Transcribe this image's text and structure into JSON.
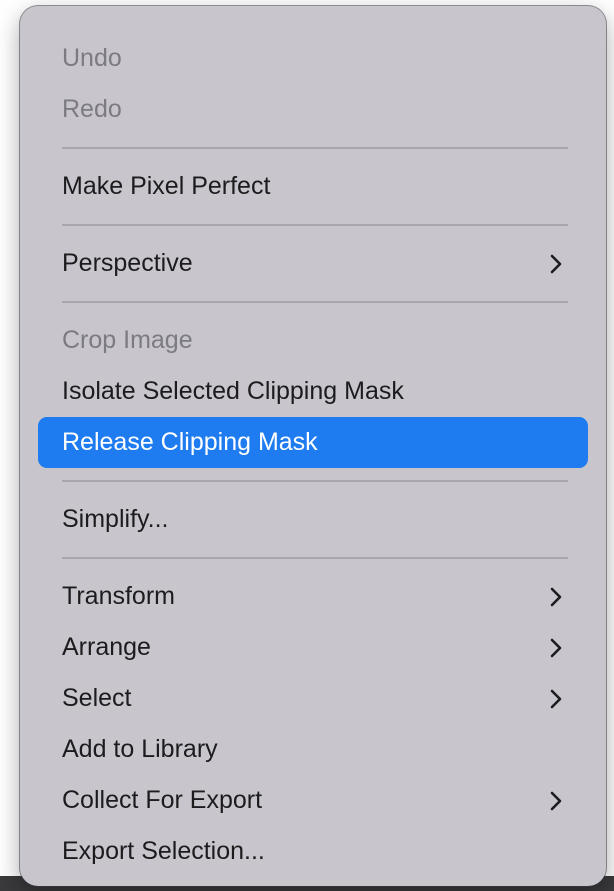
{
  "menu": {
    "groups": [
      {
        "items": [
          {
            "label": "Undo",
            "enabled": false
          },
          {
            "label": "Redo",
            "enabled": false
          }
        ]
      },
      {
        "items": [
          {
            "label": "Make Pixel Perfect",
            "enabled": true
          }
        ]
      },
      {
        "items": [
          {
            "label": "Perspective",
            "enabled": true,
            "submenu": true
          }
        ]
      },
      {
        "items": [
          {
            "label": "Crop Image",
            "enabled": false
          },
          {
            "label": "Isolate Selected Clipping Mask",
            "enabled": true
          },
          {
            "label": "Release Clipping Mask",
            "enabled": true,
            "highlighted": true
          }
        ]
      },
      {
        "items": [
          {
            "label": "Simplify...",
            "enabled": true
          }
        ]
      },
      {
        "items": [
          {
            "label": "Transform",
            "enabled": true,
            "submenu": true
          },
          {
            "label": "Arrange",
            "enabled": true,
            "submenu": true
          },
          {
            "label": "Select",
            "enabled": true,
            "submenu": true
          },
          {
            "label": "Add to Library",
            "enabled": true
          },
          {
            "label": "Collect For Export",
            "enabled": true,
            "submenu": true
          },
          {
            "label": "Export Selection...",
            "enabled": true
          }
        ]
      }
    ]
  },
  "colors": {
    "menu_background": "#c8c6cc",
    "highlight": "#1e7cf0",
    "text": "#1c1c1e",
    "disabled_text": "#7c7b82",
    "separator": "#a8a7ae"
  },
  "icons": {
    "submenu": "chevron-right-icon"
  }
}
